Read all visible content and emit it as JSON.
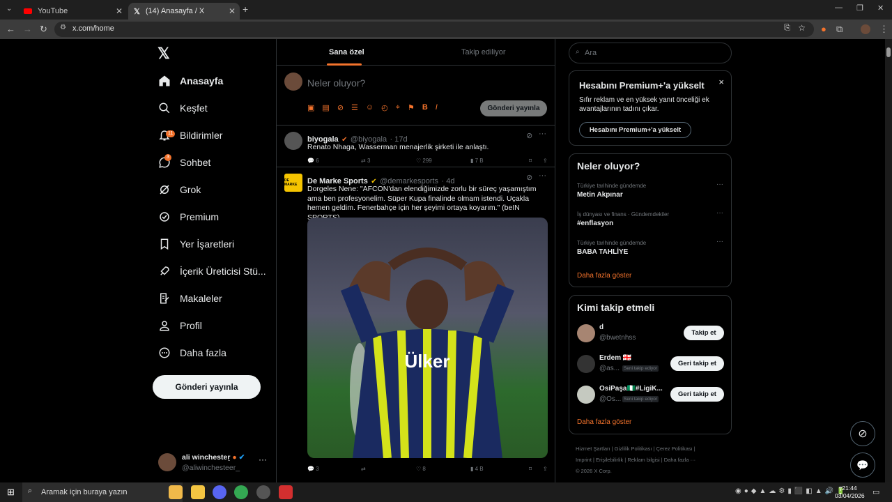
{
  "browser": {
    "tabs": [
      {
        "label": "YouTube"
      },
      {
        "label": "(14) Anasayfa / X"
      }
    ],
    "new_tab": "+",
    "url": "x.com/home"
  },
  "nav": {
    "items": [
      {
        "label": "Anasayfa",
        "icon": "home-icon"
      },
      {
        "label": "Keşfet",
        "icon": "search-icon"
      },
      {
        "label": "Bildirimler",
        "icon": "bell-icon",
        "badge": "11"
      },
      {
        "label": "Sohbet",
        "icon": "chat-icon",
        "badge": "3"
      },
      {
        "label": "Grok",
        "icon": "grok-icon"
      },
      {
        "label": "Premium",
        "icon": "premium-icon"
      },
      {
        "label": "Yer İşaretleri",
        "icon": "bookmark-icon"
      },
      {
        "label": "İçerik Üreticisi Stü...",
        "icon": "rocket-icon"
      },
      {
        "label": "Makaleler",
        "icon": "article-icon"
      },
      {
        "label": "Profil",
        "icon": "person-icon"
      },
      {
        "label": "Daha fazla",
        "icon": "more-circle-icon"
      }
    ],
    "post_button": "Gönderi yayınla",
    "user": {
      "name": "ali winchesteṛ",
      "handle": "@aliwinchesteer_"
    }
  },
  "feed": {
    "tabs": [
      "Sana özel",
      "Takip ediliyor"
    ],
    "compose": {
      "placeholder": "Neler oluyor?",
      "post_button": "Gönderi yayınla"
    },
    "tweets": [
      {
        "name": "biyogala",
        "handle": "@biyogala",
        "time": "· 17d",
        "text": "Renato Nhaga, Wasserman menajerlik şirketi ile anlaştı.",
        "replies": "6",
        "retweets": "3",
        "likes": "299",
        "views": "7 B"
      },
      {
        "name": "De Marke Sports",
        "handle": "@demarkesports",
        "time": "· 4d",
        "avatar_text": "DE MARKE",
        "text": "Dorgeles Nene: \"AFCON'dan elendiğimizde zorlu bir süreç yaşamıştım ama ben profesyonelim. Süper Kupa finalinde olmam istendi. Uçakla hemen geldim. Fenerbahçe için her şeyimi ortaya koyarım.\" (beIN SPORTS)",
        "jersey_text": "Ülker",
        "replies": "3",
        "retweets": "",
        "likes": "8",
        "views": "4 B"
      }
    ]
  },
  "sidebar": {
    "search_placeholder": "Ara",
    "premium": {
      "title": "Hesabını Premium+'a yükselt",
      "body": "Sıfır reklam ve en yüksek yanıt önceliği ek avantajlarının tadını çıkar.",
      "button": "Hesabını Premium+'a yükselt",
      "close": "×"
    },
    "trends": {
      "title": "Neler oluyor?",
      "items": [
        {
          "meta": "Türkiye tarihinde gündemde",
          "title": "Metin Akpınar"
        },
        {
          "meta": "İş dünyası ve finans · Gündemdekiler",
          "title": "#enflasyon"
        },
        {
          "meta": "Türkiye tarihinde gündemde",
          "title": "BABA TAHLİYE"
        }
      ],
      "more": "Daha fazla göster"
    },
    "who_to_follow": {
      "title": "Kimi takip etmeli",
      "items": [
        {
          "name": "d",
          "handle": "@bwetnhss",
          "button": "Takip et",
          "note": ""
        },
        {
          "name": "Erdem 🇬🇪",
          "handle": "@as...",
          "button": "Geri takip et",
          "note": "Seni takip ediyor"
        },
        {
          "name": "OsiPaşa🇳🇬#LigiK...",
          "handle": "@Os...",
          "button": "Geri takip et",
          "note": "Seni takip ediyor"
        }
      ],
      "more": "Daha fazla göster"
    },
    "footer": {
      "links": [
        "Hizmet Şartları",
        "Gizlilik Politikası",
        "Çerez Politikası",
        "Imprint",
        "Erişilebilirlik",
        "Reklam bilgisi",
        "Daha fazla ···"
      ],
      "copyright": "© 2026 X Corp."
    }
  },
  "taskbar": {
    "search": "Aramak için buraya yazın",
    "time": "21:44",
    "date": "03/04/2026"
  },
  "colors": {
    "accent": "#f4732c",
    "verified": "#1d9bf0",
    "bg": "#000000",
    "border": "#2f3336"
  }
}
